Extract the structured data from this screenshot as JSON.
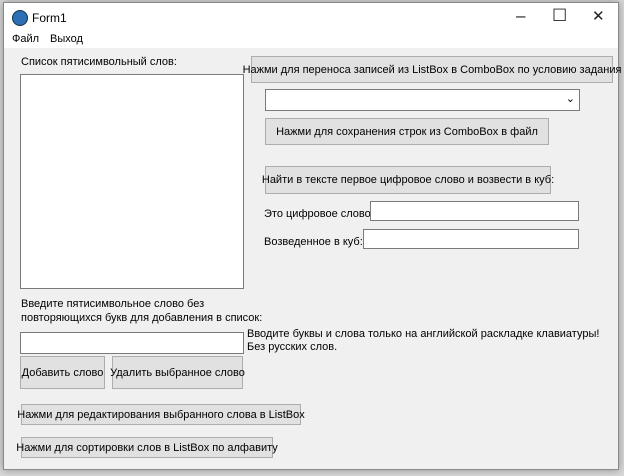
{
  "window": {
    "title": "Form1",
    "minimize": "–",
    "maximize": "☐",
    "close": "✕"
  },
  "menu": [
    "Файл",
    "Выход"
  ],
  "list_label": "Список пятисимвольный слов:",
  "buttons": {
    "transfer": "Нажми для переноса записей из ListBox в ComboBox по условию задания",
    "save": "Нажми для сохранения строк из ComboBox в файл",
    "find": "Найти в тексте первое цифровое слово и возвести в куб:",
    "add": "Добавить слово",
    "delete": "Удалить выбранное слово",
    "edit": "Нажми для редактирования выбранного слова в ListBox",
    "sort": "Нажми для сортировки слов в ListBox по алфавиту"
  },
  "combo_value": "",
  "digit_word_label": "Это цифровое слово:",
  "digit_word_value": "",
  "cube_label": "Возведенное в куб:",
  "cube_value": "",
  "input_label_1": "Введите пятисимвольное слово без",
  "input_label_2": "повторяющихся букв для добавления в список:",
  "word_input_value": "",
  "hint_1": "Вводите буквы и слова только на английской раскладке клавиатуры!",
  "hint_2": "Без русских слов."
}
